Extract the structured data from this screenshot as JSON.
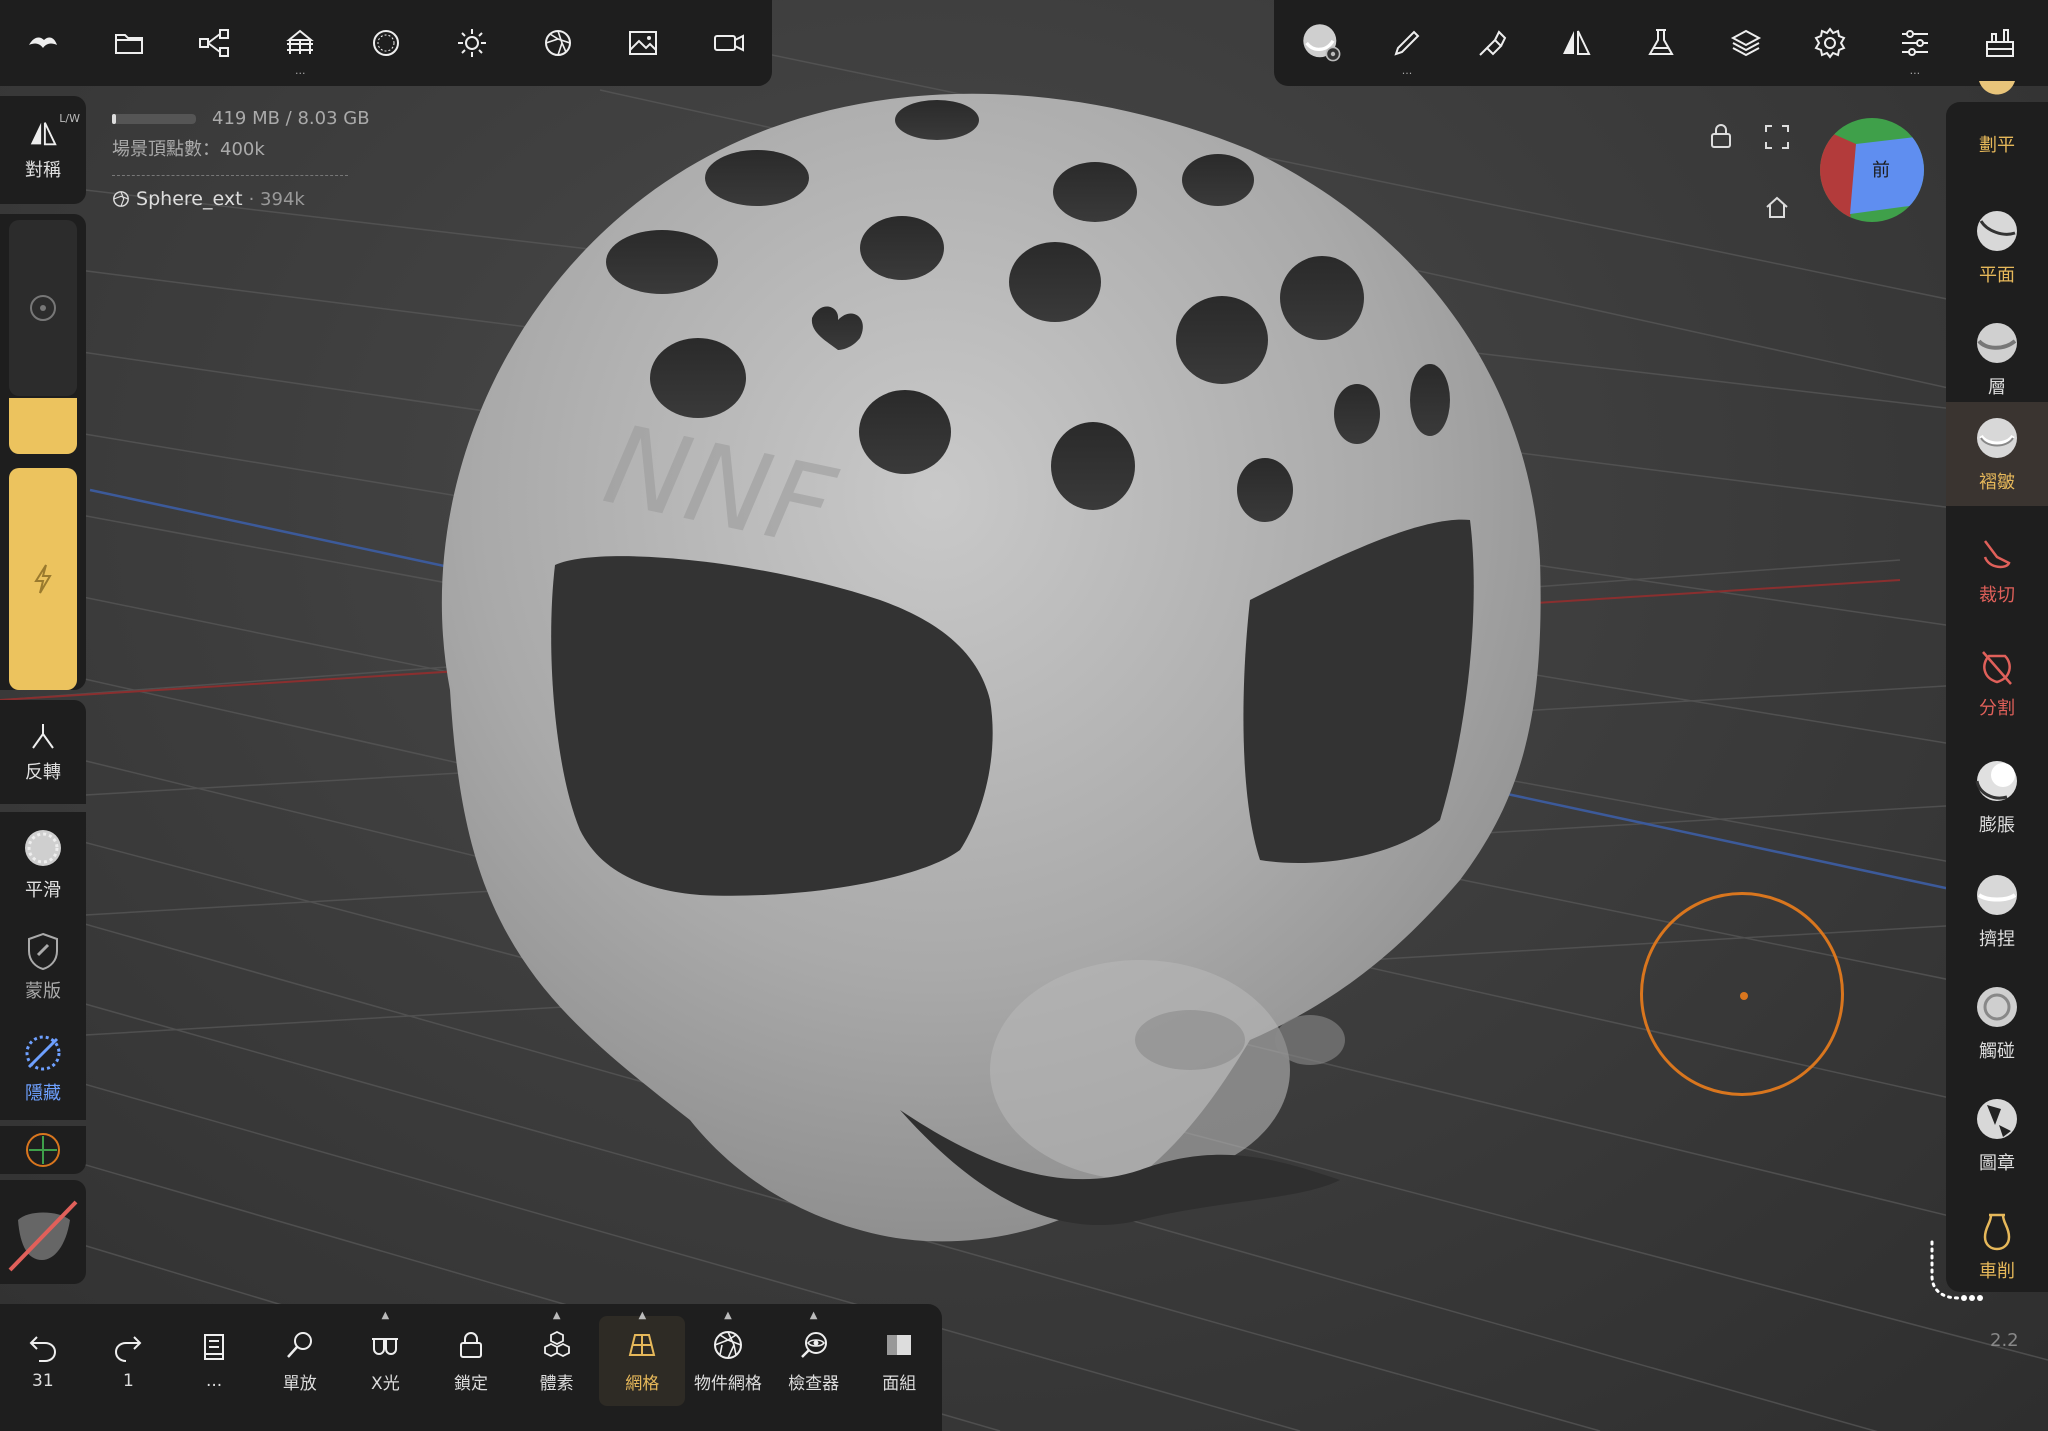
{
  "top_left_toolbar": {
    "icons": [
      "nomad-logo-icon",
      "folder-icon",
      "share-icon",
      "scene-icon",
      "material-sphere-icon",
      "light-icon",
      "shading-icon",
      "background-image-icon",
      "camera-icon"
    ]
  },
  "top_right_toolbar": {
    "icons": [
      "brush-material-icon",
      "paint-icon",
      "stroke-icon",
      "symmetry-icon",
      "lab-icon",
      "layers-icon",
      "settings-icon",
      "adjust-icon",
      "extra-icon"
    ]
  },
  "info": {
    "memory": "419 MB / 8.03 GB",
    "vertices": "場景頂點數：400k",
    "object_name": "Sphere_ext",
    "object_count": "· 394k"
  },
  "left_panel": {
    "symmetry_label": "對稱",
    "symmetry_hint": "L/W",
    "invert_label": "反轉",
    "smooth_label": "平滑",
    "mask_label": "蒙版",
    "hide_label": "隱藏"
  },
  "orientation": {
    "front_label": "前"
  },
  "right_panel": {
    "items": [
      {
        "label": "劃平"
      },
      {
        "label": "平面"
      },
      {
        "label": "層"
      },
      {
        "label": "褶皺"
      },
      {
        "label": "裁切"
      },
      {
        "label": "分割"
      },
      {
        "label": "膨脹"
      },
      {
        "label": "擠捏"
      },
      {
        "label": "觸碰"
      },
      {
        "label": "圖章"
      },
      {
        "label": "車削"
      }
    ]
  },
  "bottom_bar": {
    "undo_count": "31",
    "redo_count": "1",
    "history_label": "...",
    "solo_label": "單放",
    "xray_label": "X光",
    "lock_label": "鎖定",
    "voxel_label": "體素",
    "mesh_label": "網格",
    "object_mesh_label": "物件網格",
    "inspector_label": "檢查器",
    "facegroup_label": "面組"
  },
  "version": "2.2",
  "model_text": "NNF",
  "colors": {
    "accent": "#e6b85a",
    "brush_cursor": "#d9761e",
    "panel": "#1e1e1e",
    "red_tool": "#e0605a"
  }
}
